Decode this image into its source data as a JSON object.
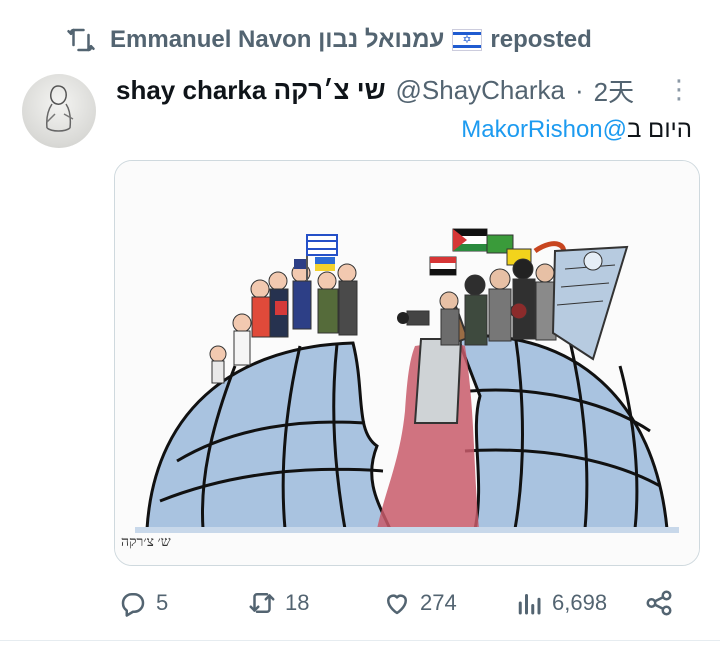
{
  "repost": {
    "name": "Emmanuel Navon עמנואל נבון",
    "suffix": "reposted",
    "flag_icon": "israel-flag-icon"
  },
  "tweet": {
    "display_name": "shay charka שי צ׳רקה",
    "handle": "@ShayCharka",
    "separator": "·",
    "time": "2天",
    "text_prefix": "היום ב",
    "mention": "@MakorRishon",
    "more_icon": "more-dots-icon"
  },
  "actions": {
    "replies": "5",
    "reposts": "18",
    "likes": "274",
    "views": "6,698"
  },
  "colors": {
    "accent": "#1d9bf0",
    "muted": "#536471",
    "globe": "#a9c3e0",
    "blood": "#c85a6a"
  }
}
